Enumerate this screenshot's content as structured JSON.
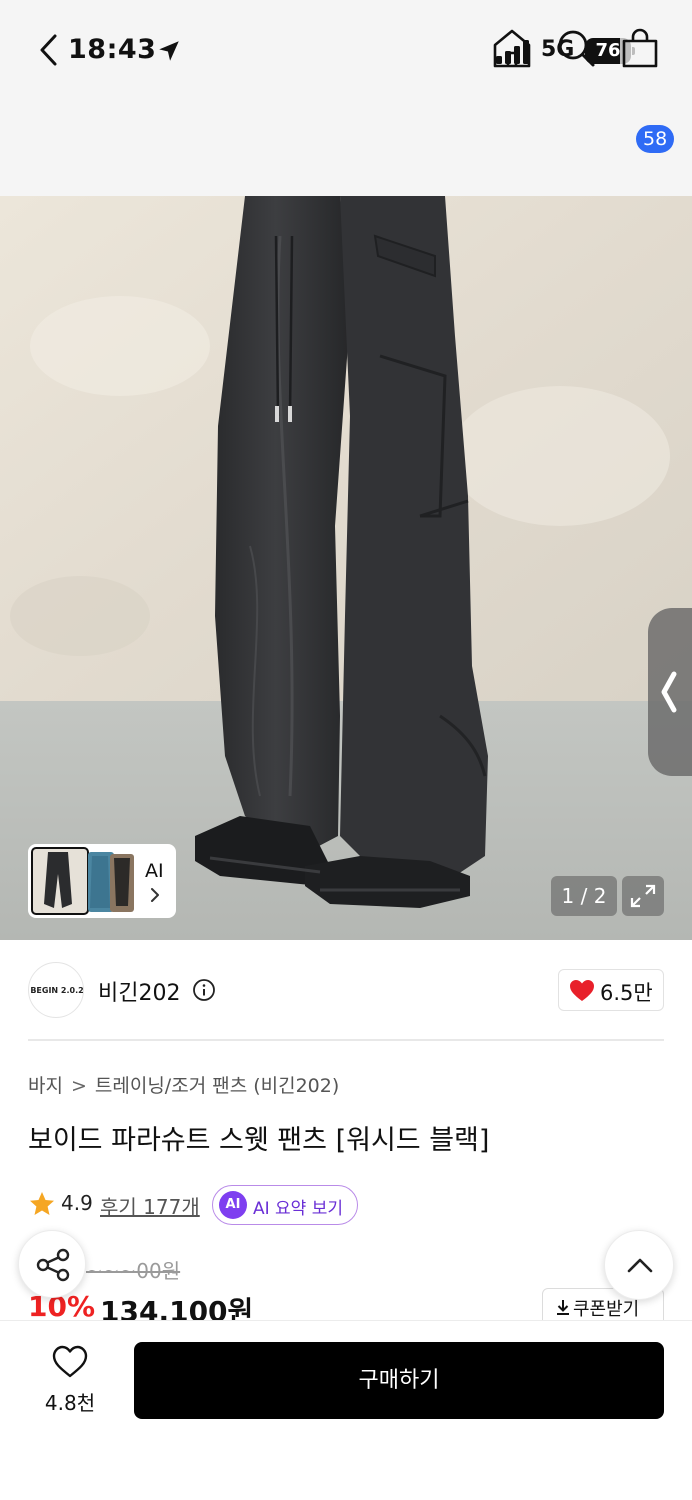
{
  "status_bar": {
    "time": "18:43",
    "network": "5G",
    "battery": "76",
    "battery_level_percent": 76,
    "icons": [
      "location-arrow-icon",
      "signal-bars-icon",
      "battery-icon"
    ]
  },
  "nav": {
    "cart_count": "58",
    "icons": [
      "back-chevron-icon",
      "home-icon",
      "search-icon",
      "shopping-bag-icon"
    ]
  },
  "gallery": {
    "thumbnail_ai_label": "AI",
    "counter": "1 / 2",
    "icons": [
      "side-tab-chevron-icon",
      "chevron-right-icon",
      "expand-icon"
    ]
  },
  "brand": {
    "logo_text": "BEGIN 2.0.2",
    "name": "비긴202",
    "like_count": "6.5만",
    "icons": [
      "info-icon",
      "heart-filled-icon"
    ]
  },
  "product": {
    "breadcrumb": [
      "바지",
      "트레이닝/조거 팬츠 (비긴202)"
    ],
    "breadcrumb_separator": ">",
    "title": "보이드 파라슈트 스웻 팬츠 [워시드 블랙]",
    "rating": "4.9",
    "reviews": "후기 177개",
    "ai_badge": "AI",
    "ai_summary": "AI 요약 보기",
    "original_price": "~~~00원",
    "discount": "10%",
    "price": "134,100원",
    "coupon": "쿠폰받기"
  },
  "bottom_bar": {
    "wishlist_count": "4.8천",
    "buy_label": "구매하기"
  },
  "colors": {
    "accent_blue": "#2f6bf5",
    "discount_red": "#ee2222",
    "heart_red": "#e8202a",
    "ai_purple": "#7e3ff0",
    "star_orange": "#f5a623"
  }
}
